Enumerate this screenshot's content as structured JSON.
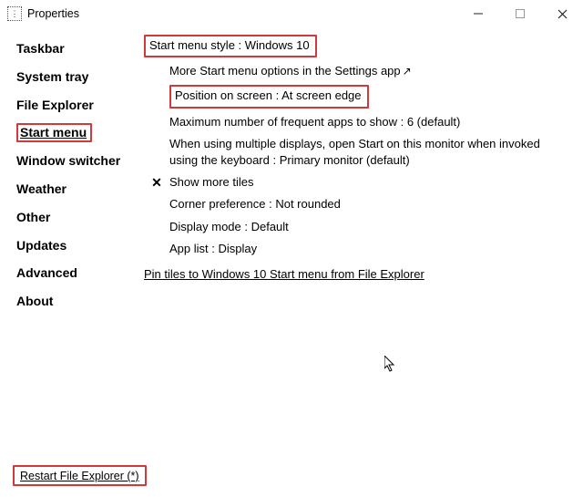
{
  "window": {
    "title": "Properties"
  },
  "sidebar": {
    "items": [
      {
        "label": "Taskbar",
        "selected": false
      },
      {
        "label": "System tray",
        "selected": false
      },
      {
        "label": "File Explorer",
        "selected": false
      },
      {
        "label": "Start menu",
        "selected": true
      },
      {
        "label": "Window switcher",
        "selected": false
      },
      {
        "label": "Weather",
        "selected": false
      },
      {
        "label": "Other",
        "selected": false
      },
      {
        "label": "Updates",
        "selected": false
      },
      {
        "label": "Advanced",
        "selected": false
      },
      {
        "label": "About",
        "selected": false
      }
    ]
  },
  "content": {
    "style_label": "Start menu style : Windows 10",
    "more_link": "More Start menu options in the Settings app",
    "position": "Position on screen : At screen edge",
    "max_apps": "Maximum number of frequent apps to show : 6 (default)",
    "multi_display": "When using multiple displays, open Start on this monitor when invoked using the keyboard : Primary monitor (default)",
    "more_tiles": "Show more tiles",
    "corner": "Corner preference : Not rounded",
    "display_mode": "Display mode : Default",
    "app_list": "App list : Display",
    "pin_link": "Pin tiles to Windows 10 Start menu from File Explorer"
  },
  "footer": {
    "restart": "Restart File Explorer (*)"
  }
}
